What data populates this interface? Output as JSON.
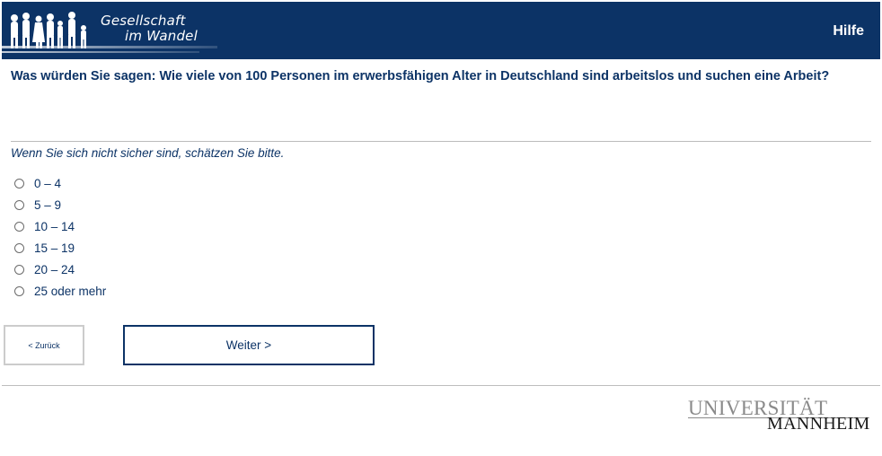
{
  "header": {
    "logo_line1": "Gesellschaft",
    "logo_line2": "im Wandel",
    "help_label": "Hilfe"
  },
  "question": {
    "text": "Was würden Sie sagen: Wie viele von 100 Personen im erwerbsfähigen Alter in Deutschland sind arbeitslos und suchen eine Arbeit?",
    "hint": "Wenn Sie sich nicht sicher sind, schätzen Sie bitte.",
    "options": [
      "0 – 4",
      "5 – 9",
      "10 – 14",
      "15 – 19",
      "20 – 24",
      "25 oder mehr"
    ]
  },
  "navigation": {
    "back_label": "< Zurück",
    "next_label": "Weiter >"
  },
  "footer": {
    "logo_top": "UNIVERSITÄT",
    "logo_bottom": "MANNHEIM"
  },
  "colors": {
    "header_bg": "#0c3366",
    "text": "#0c3366"
  }
}
